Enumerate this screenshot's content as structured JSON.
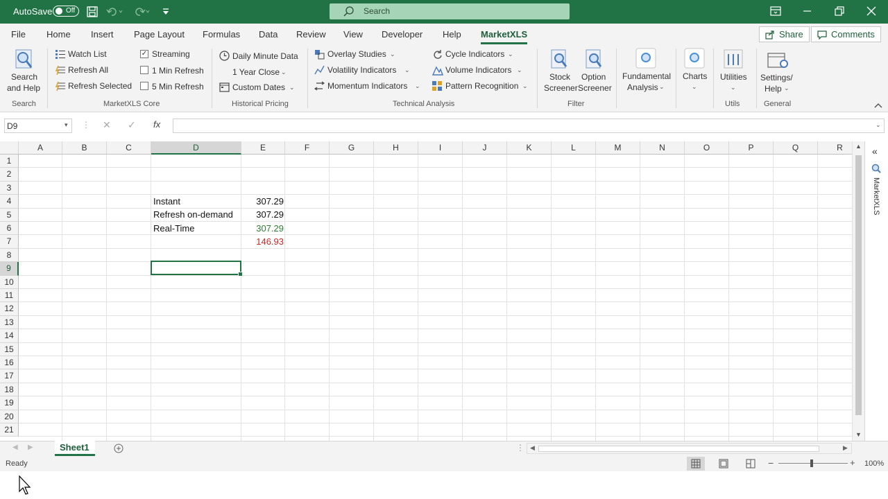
{
  "titlebar": {
    "autosave_label": "AutoSave",
    "autosave_state": "Off",
    "search_label": "Search"
  },
  "menu": {
    "tabs": [
      "File",
      "Home",
      "Insert",
      "Page Layout",
      "Formulas",
      "Data",
      "Review",
      "View",
      "Developer",
      "Help",
      "MarketXLS"
    ],
    "active_tab": "MarketXLS",
    "share": "Share",
    "comments": "Comments"
  },
  "ribbon": {
    "search_and_help": [
      "Search",
      "and Help"
    ],
    "watch_list": "Watch List",
    "refresh_all": "Refresh All",
    "refresh_selected": "Refresh Selected",
    "streaming": "Streaming",
    "one_min_refresh": "1 Min Refresh",
    "five_min_refresh": "5 Min Refresh",
    "daily_minute_data": "Daily Minute Data",
    "one_year_close": "1 Year Close",
    "custom_dates": "Custom Dates",
    "overlay_studies": "Overlay Studies",
    "volatility_indicators": "Volatility Indicators",
    "momentum_indicators": "Momentum Indicators",
    "cycle_indicators": "Cycle Indicators",
    "volume_indicators": "Volume Indicators",
    "pattern_recognition": "Pattern Recognition",
    "stock_screener": [
      "Stock",
      "Screener"
    ],
    "option_screener": [
      "Option",
      "Screener"
    ],
    "fundamental_analysis": [
      "Fundamental",
      "Analysis"
    ],
    "charts": "Charts",
    "utilities": "Utilities",
    "settings_help": [
      "Settings/",
      "Help"
    ],
    "groups": {
      "search": "Search",
      "core": "MarketXLS Core",
      "historical": "Historical Pricing",
      "technical": "Technical Analysis",
      "filter": "Filter",
      "utils": "Utils",
      "general": "General"
    }
  },
  "formula_bar": {
    "name_box": "D9",
    "fx": "fx",
    "formula": ""
  },
  "grid": {
    "columns": [
      "A",
      "B",
      "C",
      "D",
      "E",
      "F",
      "G",
      "H",
      "I",
      "J",
      "K",
      "L",
      "M",
      "N",
      "O",
      "P",
      "Q",
      "R"
    ],
    "rows": [
      "1",
      "2",
      "3",
      "4",
      "5",
      "6",
      "7",
      "8",
      "9",
      "10",
      "11",
      "12",
      "13",
      "14",
      "15",
      "16",
      "17",
      "18",
      "19",
      "20",
      "21"
    ],
    "selected_cell": "D9",
    "cells": {
      "D4": "Instant",
      "E4": "307.29",
      "D5": "Refresh on-demand",
      "E5": "307.29",
      "D6": "Real-Time",
      "E6": "307.29",
      "E7": "146.93"
    },
    "colors": {
      "green": "#2e7d32",
      "red": "#c62828"
    }
  },
  "side_pane": {
    "label": "MarketXLS"
  },
  "sheets": {
    "active": "Sheet1"
  },
  "status": {
    "text": "Ready",
    "zoom": "100%"
  }
}
